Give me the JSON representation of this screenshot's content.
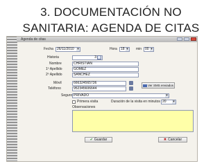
{
  "slide": {
    "title_line1": "3. DOCUMENTACIÓN NO",
    "title_line2": "SANITARIA: AGENDA DE CITAS"
  },
  "window": {
    "title": "Agenda de citas"
  },
  "form": {
    "fecha_label": "Fecha",
    "fecha_value": "26/11/2010",
    "hora_label": "Hora",
    "hora_value": "18",
    "min_label": "min",
    "min_value": "00",
    "historia_label": "Historia",
    "historia_value": "3",
    "nombre_label": "Nombre",
    "nombre_value": "CHRISTIAN",
    "apellido1_label": "1º Apellido",
    "apellido1_value": "GOMEZ",
    "apellido2_label": "2º Apellido",
    "apellido2_value": "SANCHEZ",
    "movil_label": "Móvil",
    "movil_value": "666324565736",
    "sms_label": "Ver SMS enviados",
    "telefono_label": "Teléfono",
    "telefono_value": "952345606644",
    "seguro_label": "Seguro",
    "seguro_value": "PRIVADO",
    "primera_visita_label": "Primera visita",
    "duracion_label": "Duración de la visita en minutos",
    "duracion_value": "20",
    "observaciones_label": "Observaciones",
    "observaciones_value": ""
  },
  "buttons": {
    "guardar": "Guardar",
    "cancelar": "Cancelar"
  },
  "icons": {
    "arrow": "▾",
    "ok": "✔",
    "cancel": "✖"
  },
  "colors": {
    "observations_bg": "#ffffa8",
    "titlebar": "#c8c8c8"
  }
}
